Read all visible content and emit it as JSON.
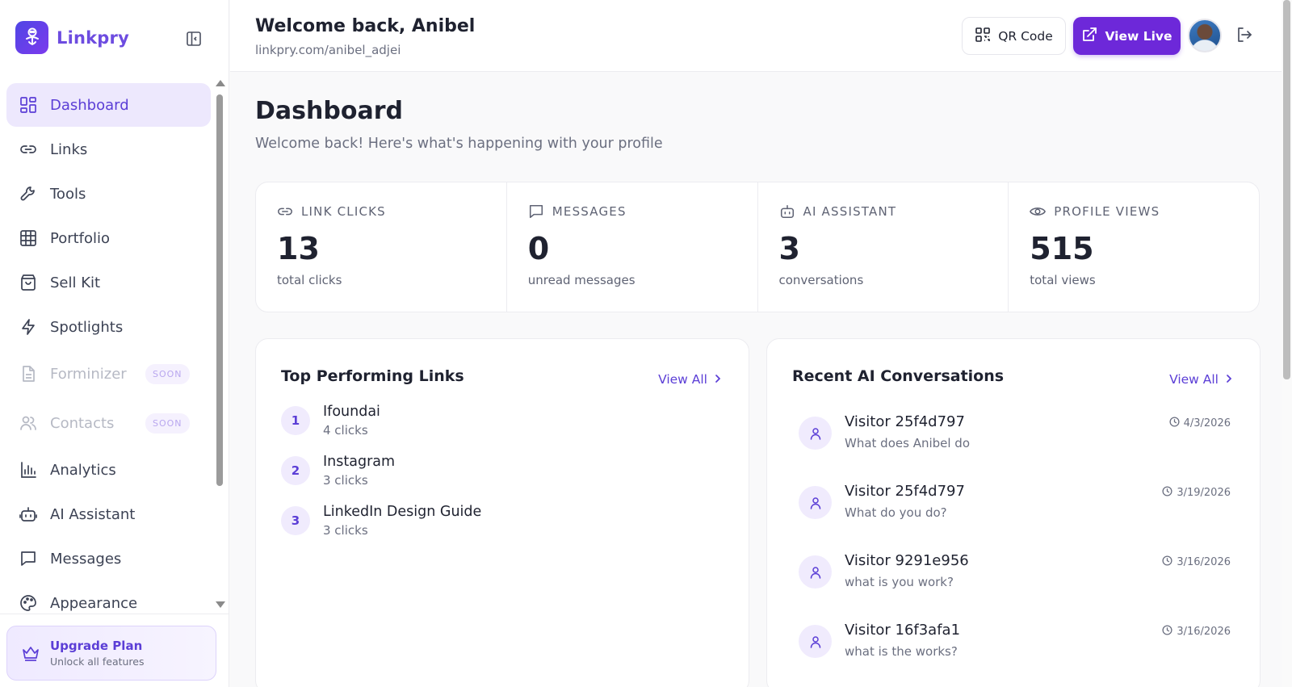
{
  "app": {
    "brand": "Linkpry"
  },
  "sidebar": {
    "items": [
      {
        "label": "Dashboard",
        "icon": "dashboard-icon",
        "active": true
      },
      {
        "label": "Links",
        "icon": "link-icon"
      },
      {
        "label": "Tools",
        "icon": "wrench-icon"
      },
      {
        "label": "Portfolio",
        "icon": "grid-icon"
      },
      {
        "label": "Sell Kit",
        "icon": "shopping-bag-icon"
      },
      {
        "label": "Spotlights",
        "icon": "lightning-icon"
      },
      {
        "label": "Forminizer",
        "icon": "document-icon",
        "badge": "SOON",
        "disabled": true
      },
      {
        "label": "Contacts",
        "icon": "users-icon",
        "badge": "SOON",
        "disabled": true
      },
      {
        "label": "Analytics",
        "icon": "bar-chart-icon"
      },
      {
        "label": "AI Assistant",
        "icon": "bot-icon"
      },
      {
        "label": "Messages",
        "icon": "message-icon"
      },
      {
        "label": "Appearance",
        "icon": "palette-icon"
      }
    ],
    "upgrade": {
      "title": "Upgrade Plan",
      "subtitle": "Unlock all features"
    }
  },
  "header": {
    "welcome": "Welcome back, Anibel",
    "handle": "linkpry.com/anibel_adjei",
    "qr_label": "QR Code",
    "live_label": "View Live"
  },
  "main": {
    "title": "Dashboard",
    "subtitle": "Welcome back! Here's what's happening with your profile",
    "stats": [
      {
        "label": "LINK CLICKS",
        "value": "13",
        "caption": "total clicks",
        "icon": "link-icon"
      },
      {
        "label": "MESSAGES",
        "value": "0",
        "caption": "unread messages",
        "icon": "message-icon"
      },
      {
        "label": "AI ASSISTANT",
        "value": "3",
        "caption": "conversations",
        "icon": "bot-icon"
      },
      {
        "label": "PROFILE VIEWS",
        "value": "515",
        "caption": "total views",
        "icon": "eye-icon"
      }
    ],
    "top_links": {
      "title": "Top Performing Links",
      "view_all": "View All",
      "items": [
        {
          "rank": "1",
          "name": "Ifoundai",
          "clicks": "4 clicks"
        },
        {
          "rank": "2",
          "name": "Instagram",
          "clicks": "3 clicks"
        },
        {
          "rank": "3",
          "name": "LinkedIn Design Guide",
          "clicks": "3 clicks"
        }
      ]
    },
    "conversations": {
      "title": "Recent AI Conversations",
      "view_all": "View All",
      "items": [
        {
          "visitor": "Visitor 25f4d797",
          "message": "What does Anibel do",
          "date": "4/3/2026"
        },
        {
          "visitor": "Visitor 25f4d797",
          "message": "What do you do?",
          "date": "3/19/2026"
        },
        {
          "visitor": "Visitor 9291e956",
          "message": "what is you work?",
          "date": "3/16/2026"
        },
        {
          "visitor": "Visitor 16f3afa1",
          "message": "what is the works?",
          "date": "3/16/2026"
        }
      ]
    }
  },
  "colors": {
    "accent": "#6d28d9",
    "active_bg": "#ede8fd",
    "text": "#1f2230",
    "muted": "#6b6f80"
  }
}
